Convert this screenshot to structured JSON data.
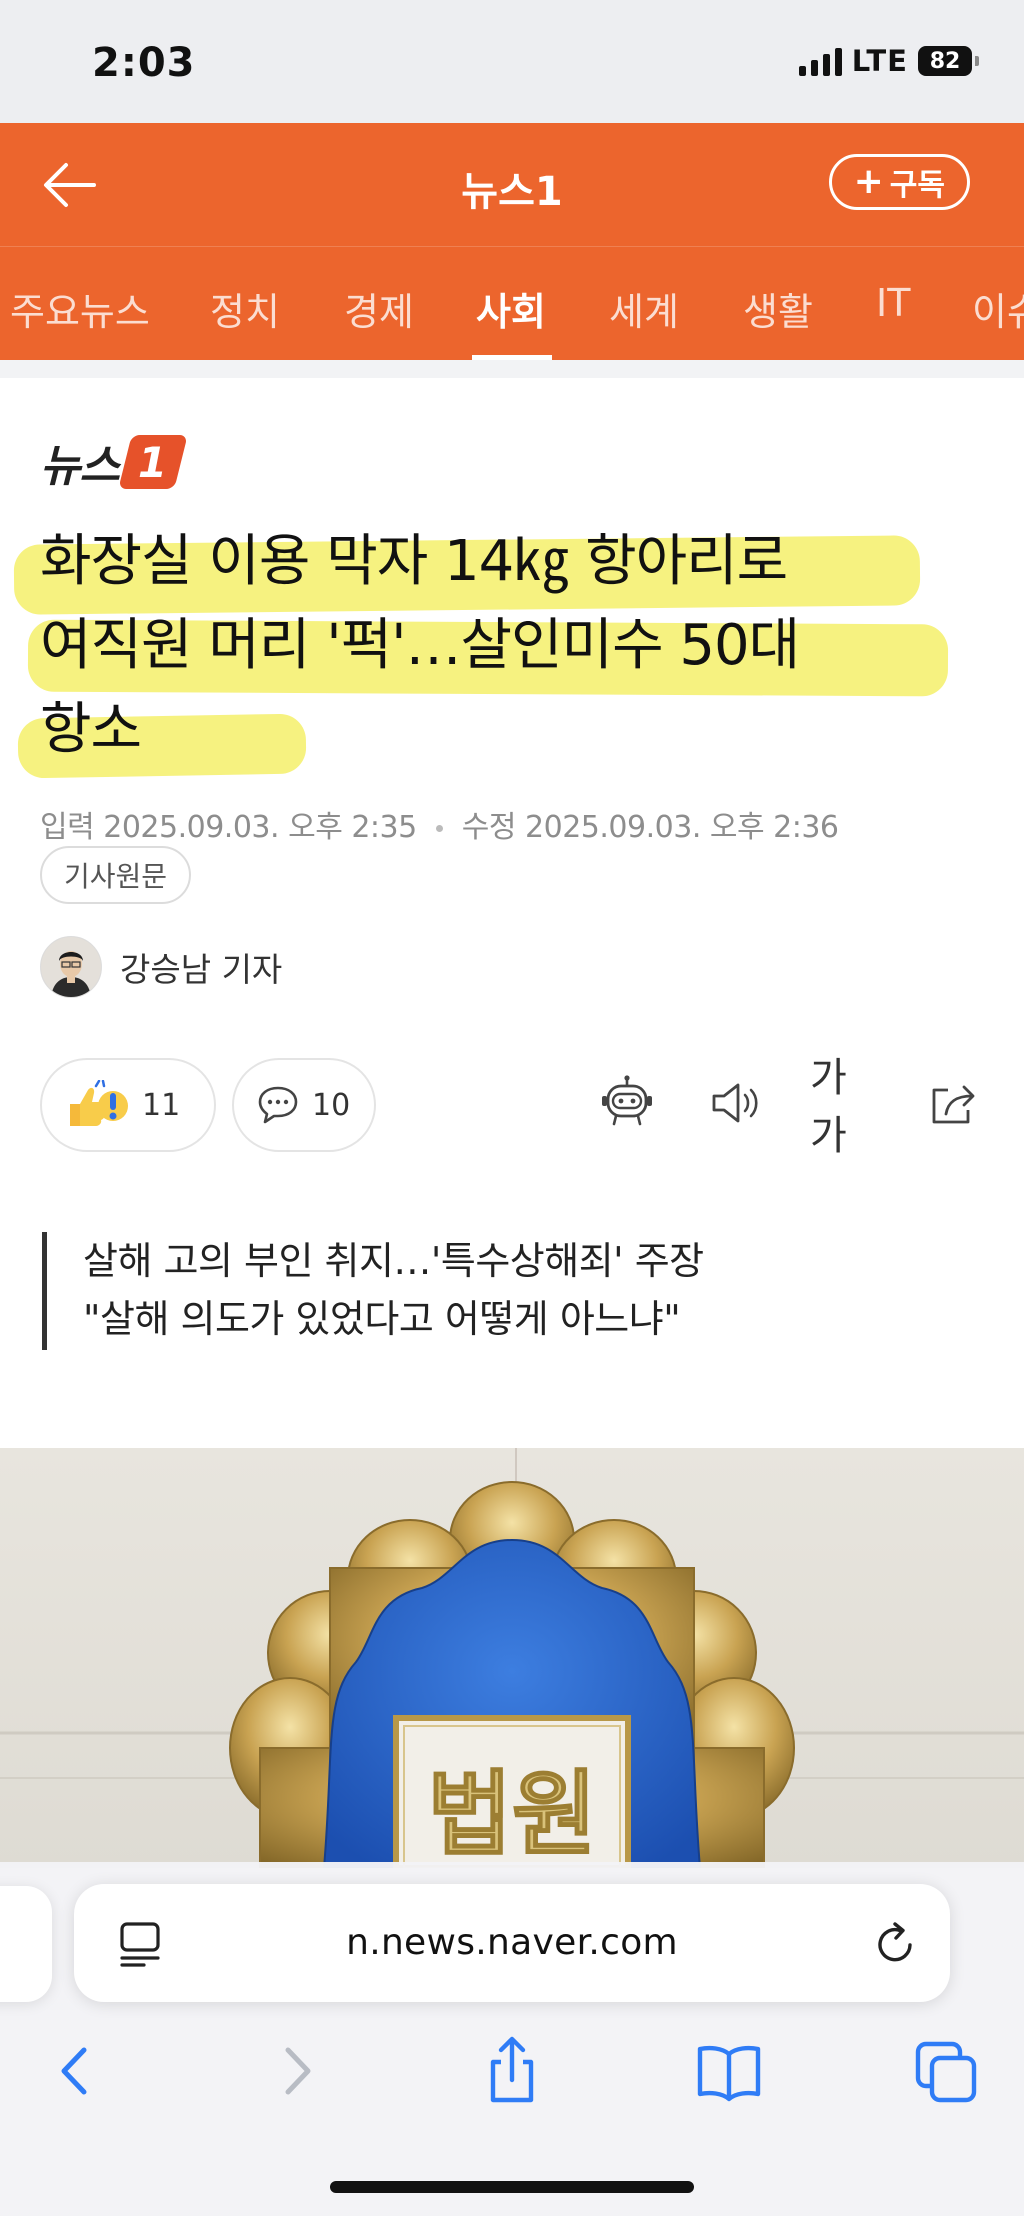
{
  "status_bar": {
    "time": "2:03",
    "network": "LTE",
    "battery": "82"
  },
  "app_bar": {
    "title": "뉴스1",
    "subscribe_label": "구독"
  },
  "tabs": [
    "주요뉴스",
    "정치",
    "경제",
    "사회",
    "세계",
    "생활",
    "IT",
    "이슈"
  ],
  "active_tab": "사회",
  "publisher": {
    "logo_text": "뉴스",
    "logo_mark": "1"
  },
  "article": {
    "headline_lines": [
      "화장실 이용 막자 14㎏ 항아리로",
      "여직원 머리 '퍽'…살인미수 50대",
      "항소"
    ],
    "input_label": "입력",
    "input_time": "2025.09.03. 오후 2:35",
    "modified_label": "수정",
    "modified_time": "2025.09.03. 오후 2:36",
    "source_button": "기사원문",
    "reporter": "강승남 기자",
    "reaction_count": "11",
    "comment_count": "10",
    "font_size_label": "가가",
    "summary_lines": [
      "살해 고의 부인 취지…'특수상해죄' 주장",
      "\"살해 의도가 있었다고 어떻게 아느냐\""
    ],
    "photo_text": "법원"
  },
  "browser": {
    "url": "n.news.naver.com"
  },
  "colors": {
    "brand_orange": "#ec652d",
    "highlight": "#f5f06a",
    "ios_blue": "#2f7cf6"
  }
}
